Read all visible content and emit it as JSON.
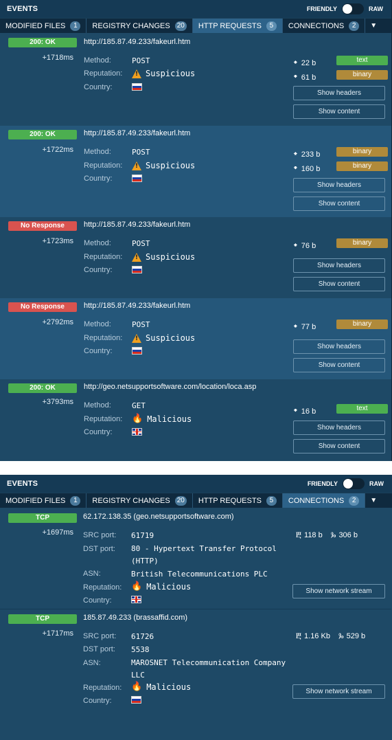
{
  "top_panel": {
    "title": "EVENTS",
    "toggle_left": "FRIENDLY",
    "toggle_right": "RAW",
    "tabs": [
      {
        "label": "MODIFIED FILES",
        "count": "1"
      },
      {
        "label": "REGISTRY CHANGES",
        "count": "20"
      },
      {
        "label": "HTTP REQUESTS",
        "count": "5"
      },
      {
        "label": "CONNECTIONS",
        "count": "2"
      }
    ],
    "more_icon": "chevron-down-icon"
  },
  "labels": {
    "method": "Method:",
    "reputation": "Reputation:",
    "country": "Country:",
    "src_port": "SRC port:",
    "dst_port": "DST port:",
    "asn": "ASN:",
    "show_headers": "Show headers",
    "show_content": "Show content",
    "show_stream": "Show network stream"
  },
  "http_requests": [
    {
      "status": "200: OK",
      "time": "+1718ms",
      "url": "http://185.87.49.233/fakeurl.htm",
      "method": "POST",
      "reputation": "Suspicious",
      "country_flag": "russia-flag-icon",
      "up": "22 b",
      "up_type": "text",
      "down": "61 b",
      "down_type": "binary"
    },
    {
      "status": "200: OK",
      "time": "+1722ms",
      "url": "http://185.87.49.233/fakeurl.htm",
      "method": "POST",
      "reputation": "Suspicious",
      "country_flag": "russia-flag-icon",
      "up": "233 b",
      "up_type": "binary",
      "down": "160 b",
      "down_type": "binary"
    },
    {
      "status": "No Response",
      "time": "+1723ms",
      "url": "http://185.87.49.233/fakeurl.htm",
      "method": "POST",
      "reputation": "Suspicious",
      "country_flag": "russia-flag-icon",
      "up": "76 b",
      "up_type": "binary"
    },
    {
      "status": "No Response",
      "time": "+2792ms",
      "url": "http://185.87.49.233/fakeurl.htm",
      "method": "POST",
      "reputation": "Suspicious",
      "country_flag": "russia-flag-icon",
      "up": "77 b",
      "up_type": "binary"
    },
    {
      "status": "200: OK",
      "time": "+3793ms",
      "url": "http://geo.netsupportsoftware.com/location/loca.asp",
      "method": "GET",
      "reputation": "Malicious",
      "country_flag": "uk-flag-icon",
      "down": "16 b",
      "down_type": "text"
    }
  ],
  "bottom_panel": {
    "title": "EVENTS",
    "toggle_left": "FRIENDLY",
    "toggle_right": "RAW",
    "tabs": [
      {
        "label": "MODIFIED FILES",
        "count": "1"
      },
      {
        "label": "REGISTRY CHANGES",
        "count": "20"
      },
      {
        "label": "HTTP REQUESTS",
        "count": "5"
      },
      {
        "label": "CONNECTIONS",
        "count": "2"
      }
    ]
  },
  "connections": [
    {
      "protocol": "TCP",
      "time": "+1697ms",
      "host": "62.172.138.35 (geo.netsupportsoftware.com)",
      "src_port": "61719",
      "dst_port": "80 - Hypertext Transfer Protocol (HTTP)",
      "asn": "British Telecommunications PLC",
      "reputation": "Malicious",
      "country_flag": "uk-flag-icon",
      "upload": "118 b",
      "download": "306 b"
    },
    {
      "protocol": "TCP",
      "time": "+1717ms",
      "host": "185.87.49.233 (brassaffid.com)",
      "src_port": "61726",
      "dst_port": "5538",
      "asn": "MAROSNET Telecommunication Company LLC",
      "reputation": "Malicious",
      "country_flag": "russia-flag-icon",
      "upload": "1.16 Kb",
      "download": "529 b"
    }
  ]
}
